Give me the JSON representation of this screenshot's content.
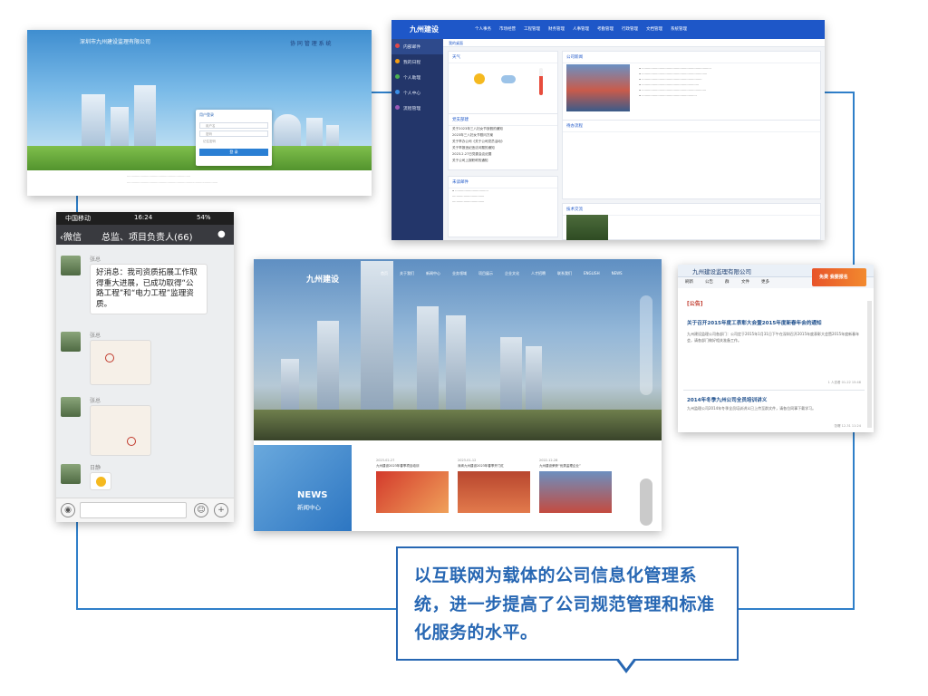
{
  "login_page": {
    "company_name": "深圳市九州建设监理有限公司",
    "system_name": "协 同 管 理 系 统",
    "panel_title": "用户登录",
    "username_placeholder": "用户名",
    "password_placeholder": "密码",
    "remember_label": "记住密码",
    "submit_label": "登 录"
  },
  "office_portal": {
    "brand": "九州建设",
    "nav": [
      "个人事务",
      "市场经营",
      "工程管理",
      "财务管理",
      "人事管理",
      "考勤管理",
      "行政管理",
      "文档管理",
      "系统管理"
    ],
    "sidebar": [
      "内部邮件",
      "我的日程",
      "个人助理",
      "个人中心",
      "流程管理"
    ],
    "tab": "我的桌面",
    "weather_title": "天气",
    "notice_title": "党支部建",
    "notice_items": [
      "关于2023年三八妇女节放假的通知",
      "2023年三八妇女节慰问方案",
      "关于举办公司《关于公司党员活动》",
      "关于举报违纪违法问题的通知",
      "2023.2.27日党委会议纪要",
      "关于公司上报职称的通知"
    ],
    "pending_title": "未读邮件",
    "news_title": "公司新闻",
    "flow_title": "待办流程",
    "tech_title": "技术交流"
  },
  "phone_chat": {
    "carrier": "中国移动",
    "time": "16:24",
    "battery": "54%",
    "back_label": "微信",
    "group_title": "总监、项目负责人(66)",
    "messages": [
      {
        "sender": "张总",
        "text": "好消息：我司资质拓展工作取得重大进展，已成功取得“公路工程”和“电力工程”监理资质。"
      },
      {
        "sender": "张总",
        "text": ""
      },
      {
        "sender": "张总",
        "text": ""
      },
      {
        "sender": "日静",
        "text": ""
      }
    ]
  },
  "website": {
    "brand": "九州建设",
    "nav": [
      "首页",
      "关于我们",
      "新闻中心",
      "业务领域",
      "项目展示",
      "企业文化",
      "人才招聘",
      "联系我们",
      "ENGLISH",
      "NEWS"
    ],
    "news_en": "NEWS",
    "news_cn": "新闻中心",
    "articles": [
      {
        "date": "2023-02-27",
        "title": "九州建设2023年春季项目培训"
      },
      {
        "date": "2023-01-12",
        "title": "深圳九州建设2023年春季开门红"
      },
      {
        "date": "2022-12-28",
        "title": "九州建设荣获“优秀监理企业”"
      }
    ]
  },
  "notice_window": {
    "title": "九州建设监理有限公司",
    "toolbar": [
      "刷新",
      "公告",
      "群",
      "文件",
      "更多"
    ],
    "ad_text": "免费 我要报名",
    "items": [
      {
        "tag": "[公告]",
        "title": "关于召开2015年度工表彰大会暨2015年度新春年会的通知",
        "body": "九州建设监理公司各部门：公司定于2015年1月31日下午在深圳召开2015年度表彰大会暨2015年度新春年会，请各部门做好相关准备工作。",
        "meta": "1 人查看 01-22 15:48"
      },
      {
        "tag": "",
        "title": "2014年冬季九州公司全员培训讲义",
        "body": "九州监理公司2014年冬季全员培训讲义已上传至群文件，请各位同事下载学习。",
        "meta": "张曙 12-31 11:24"
      }
    ]
  },
  "caption": {
    "text": "以互联网为载体的公司信息化管理系统，进一步提高了公司规范管理和标准化服务的水平。"
  },
  "colors": {
    "accent_blue": "#2767b3",
    "line_blue": "#2f7fc9",
    "portal_blue": "#1e57c8"
  }
}
